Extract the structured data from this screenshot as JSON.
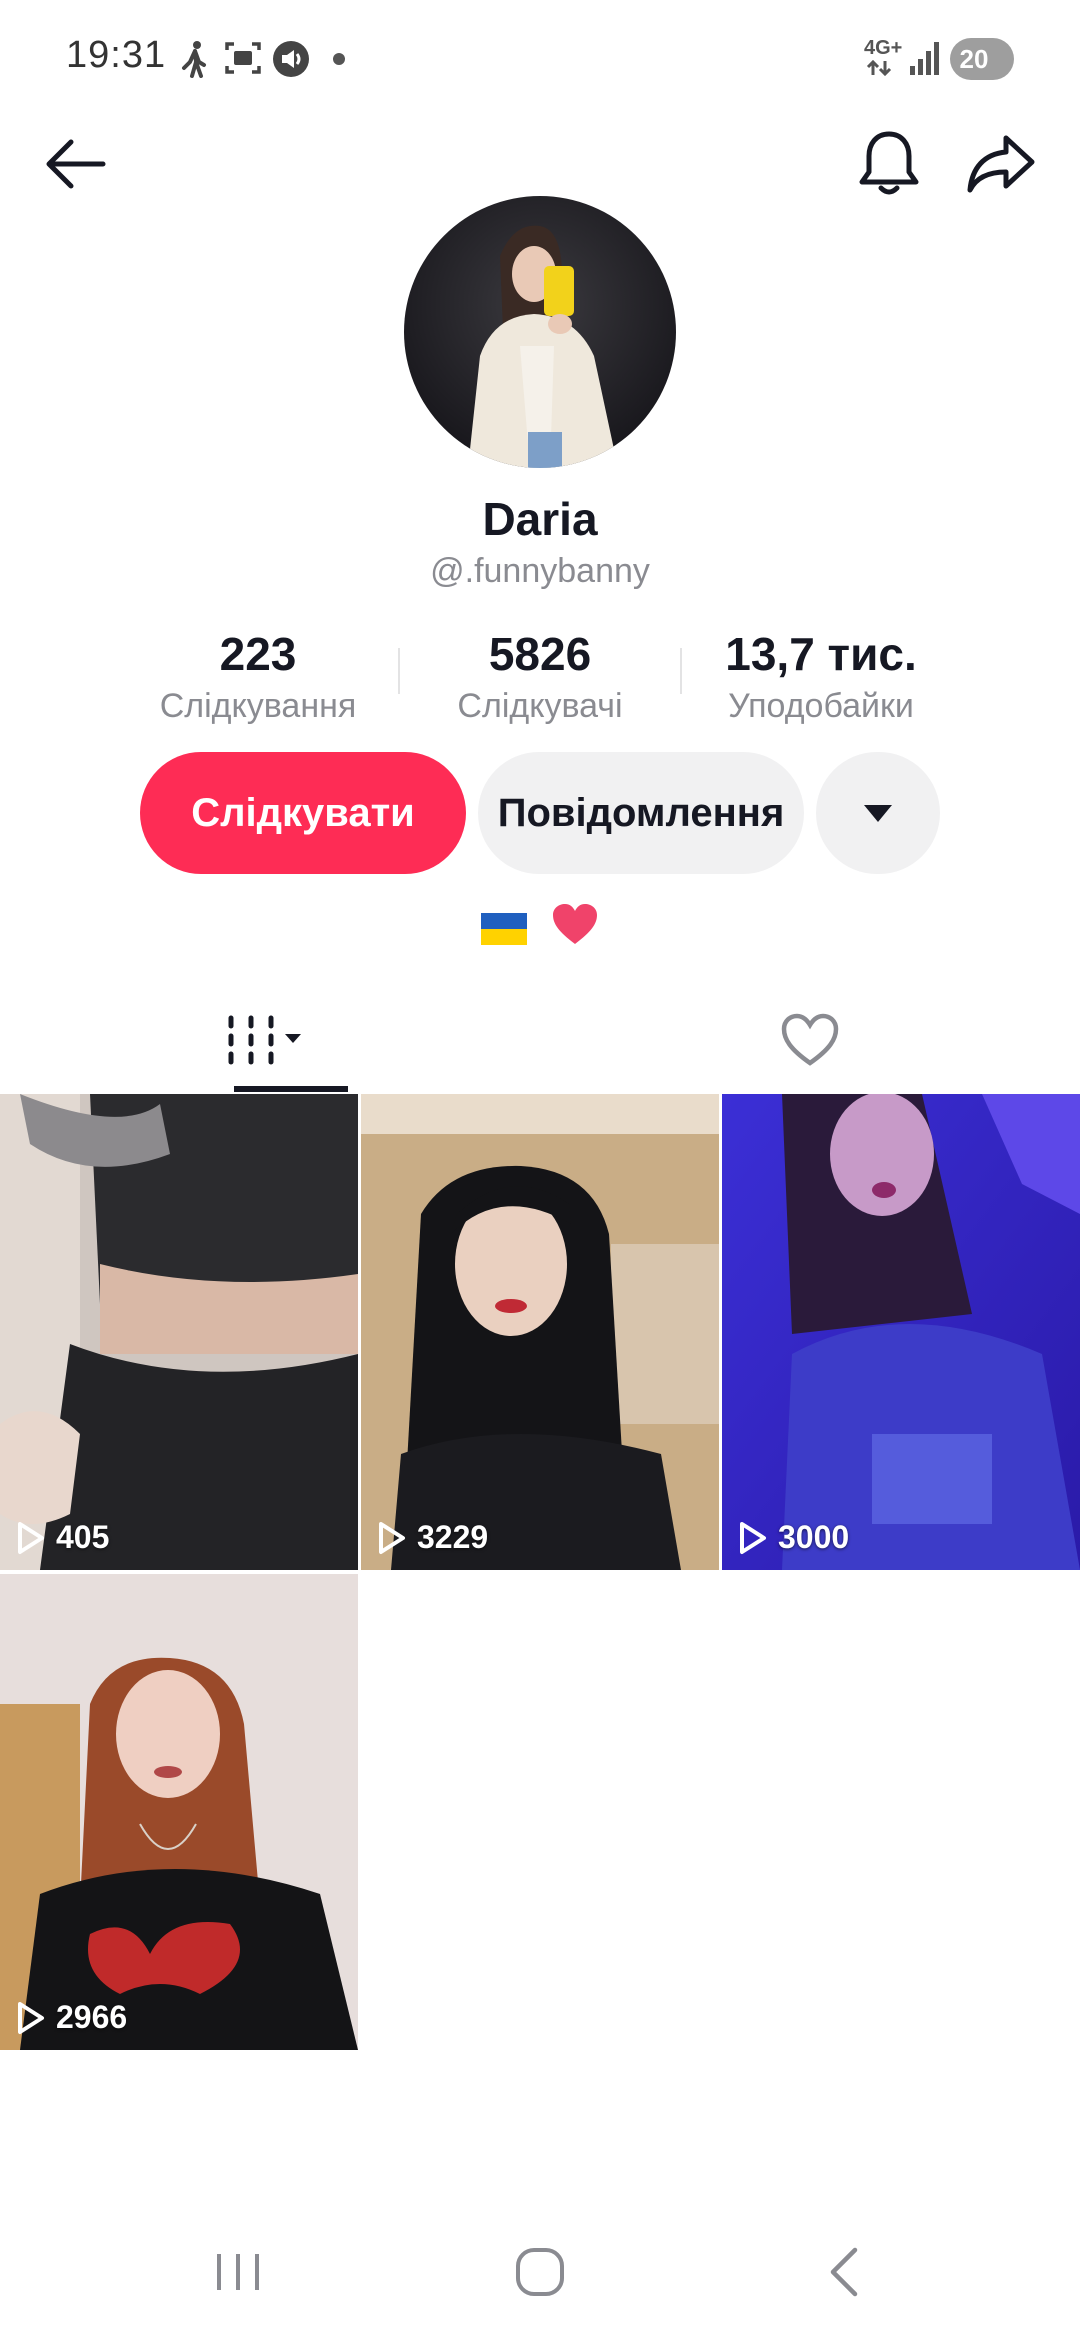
{
  "status_bar": {
    "time": "19:31",
    "network": "4G+",
    "battery": "20",
    "icons": [
      "walk-icon",
      "screenshot-icon",
      "media-output-icon",
      "dot-icon",
      "signal-icon"
    ]
  },
  "header": {
    "back_icon": "arrow-left-icon",
    "notifications_icon": "bell-icon",
    "share_icon": "share-arrow-icon"
  },
  "profile": {
    "display_name": "Daria",
    "username": "@.funnybanny",
    "stats": [
      {
        "value": "223",
        "label": "Слідкування"
      },
      {
        "value": "5826",
        "label": "Слідкувачі"
      },
      {
        "value": "13,7 тис.",
        "label": "Уподобайки"
      }
    ],
    "follow_button": "Слідкувати",
    "message_button": "Повідомлення",
    "more_icon": "caret-down-icon",
    "bio_emojis": [
      "ukraine-flag",
      "red-heart"
    ]
  },
  "tabs": {
    "videos_icon": "grid-videos-icon",
    "liked_icon": "heart-outline-icon",
    "active": "videos"
  },
  "videos": [
    {
      "views": "405"
    },
    {
      "views": "3229"
    },
    {
      "views": "3000"
    },
    {
      "views": "2966"
    }
  ],
  "nav_bar": {
    "recent_icon": "recents-icon",
    "home_icon": "home-icon",
    "back_icon": "back-chevron-icon"
  },
  "colors": {
    "accent": "#fe2c55",
    "secondary_button": "#f1f1f2",
    "muted_text": "#8a8b91"
  }
}
